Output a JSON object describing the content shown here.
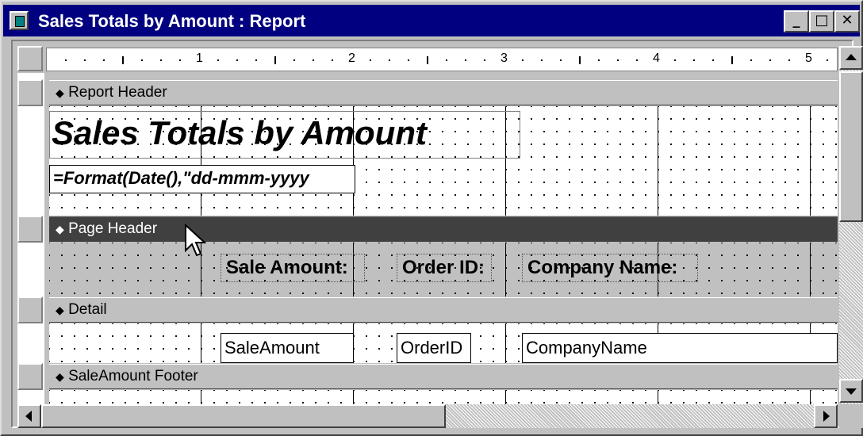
{
  "window": {
    "title": "Sales Totals by Amount : Report",
    "buttons": {
      "minimize": "_",
      "maximize": "□",
      "close": "✕"
    }
  },
  "ruler": {
    "ticks": [
      "1",
      "2",
      "3",
      "4",
      "5"
    ]
  },
  "sections": {
    "report_header": "Report Header",
    "page_header": "Page Header",
    "detail": "Detail",
    "saleamount_footer": "SaleAmount Footer"
  },
  "report_header": {
    "title_label": "Sales Totals by Amount",
    "date_textbox": "=Format(Date(),\"dd-mmm-yyyy"
  },
  "page_header": {
    "sale_amount_label": "Sale Amount:",
    "order_id_label": "Order ID:",
    "company_name_label": "Company Name:"
  },
  "detail": {
    "sale_amount_field": "SaleAmount",
    "order_id_field": "OrderID",
    "company_name_field": "CompanyName"
  },
  "icons": {
    "app": "report-icon",
    "section": "section-arrow-icon",
    "cursor": "mouse-pointer-icon"
  },
  "colors": {
    "titlebar": "#000080",
    "page_header_bar": "#404040",
    "face": "#c0c0c0"
  }
}
